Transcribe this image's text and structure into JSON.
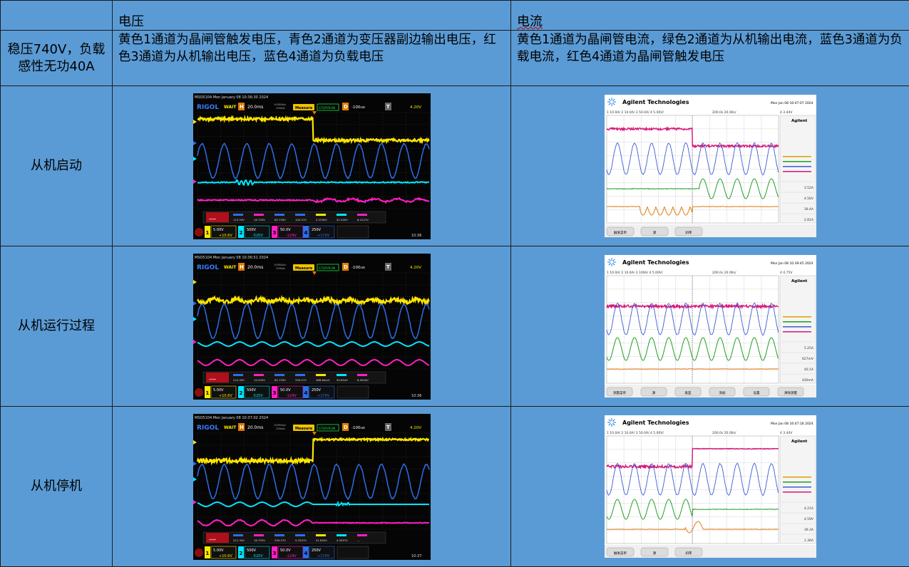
{
  "header": {
    "col_voltage": "电压",
    "col_current": "电流"
  },
  "condition_row": {
    "label": "稳压740V，负载感性无功40A",
    "voltage_desc": "黄色1通道为晶闸管触发电压，青色2通道为变压器副边输出电压，红色3通道为从机输出电压，蓝色4通道为负载电压",
    "current_desc": "黄色1通道为晶闸管电流，绿色2通道为从机输出电流，蓝色3通道为负载电流，红色4通道为晶闸管触发电压"
  },
  "rows": [
    {
      "label": "从机启动",
      "rigol": {
        "header": "MSO5104  Mon January 08 10:36:30 2024",
        "brand": "RIGOL",
        "status": "WAIT",
        "timebase": "20.0ms",
        "sample": "100MSa/s 20Mpts",
        "measure": "Measure",
        "stop": "STOP/RUN",
        "delay": "-100us",
        "trig": "4.20V",
        "meas_values": [
          "123.53V",
          "16.753V",
          "85.759V",
          "100.57V",
          "5.229kV",
          "51.945V",
          "6.1227V"
        ],
        "ch1": "5.00V",
        "ch1_off": "+10.6V",
        "ch2": "500V",
        "ch2_off": "-520V",
        "ch3": "50.0V",
        "ch3_off": "-124V",
        "ch4": "250V",
        "ch4_off": "+170V",
        "clock": "10:36"
      },
      "agilent": {
        "brand": "Agilent Technologies",
        "datetime": "Mon Jan 08 16:47:07 2024",
        "scales": "1  10.0A/   2  10.0A/   3  50.0A/   4  5.00V/",
        "time": "200.0s   20.00s/",
        "trig": "4   3.44V",
        "side_values": [
          "3.52A",
          "4.56V",
          "39.4A",
          "2.81A"
        ],
        "softkeys": [
          "触发菜单",
          "源",
          "斜率"
        ]
      }
    },
    {
      "label": "从机运行过程",
      "rigol": {
        "header": "MSO5104  Mon January 08 10:36:51 2024",
        "brand": "RIGOL",
        "status": "WAIT",
        "timebase": "20.0ms",
        "sample": "100MSa/s 20Mpts",
        "measure": "Measure",
        "stop": "STOP/RUN",
        "delay": "-100us",
        "trig": "4.20V",
        "meas_values": [
          "224.59V",
          "14.503V",
          "85.759V",
          "339.57V",
          "488.84mV",
          "55.654V",
          "6.0940V"
        ],
        "ch1": "5.00V",
        "ch1_off": "+10.6V",
        "ch2": "500V",
        "ch2_off": "-520V",
        "ch3": "50.0V",
        "ch3_off": "-124V",
        "ch4": "250V",
        "ch4_off": "+170V",
        "clock": "10:36"
      },
      "agilent": {
        "brand": "Agilent Technologies",
        "datetime": "Mon Jan 08 10:39:45 2024",
        "scales": "1  10.0A/   2  10.0A/   3  100A/   4  5.00V/",
        "time": "200.0s   20.00s/",
        "trig": "4   4.75V",
        "side_values": [
          "5.25A",
          "627mV",
          "40.1A",
          "430mA"
        ],
        "softkeys": [
          "测量菜单",
          "源",
          "类型",
          "添加",
          "设置",
          "清除测量"
        ]
      }
    },
    {
      "label": "从机停机",
      "rigol": {
        "header": "MSO5104  Mon January 08 10:37:02 2024",
        "brand": "RIGOL",
        "status": "WAIT",
        "timebase": "20.0ms",
        "sample": "100MSa/s 20Mpts",
        "measure": "Measure",
        "stop": "STOP/RUN",
        "delay": "-100us",
        "trig": "4.20V",
        "meas_values": [
          "221.34V",
          "16.753V",
          "339.57V",
          "5.2307V",
          "41.850V",
          "4.3597V",
          "..."
        ],
        "ch1": "5.00V",
        "ch1_off": "+10.6V",
        "ch2": "500V",
        "ch2_off": "-520V",
        "ch3": "50.0V",
        "ch3_off": "-124V",
        "ch4": "250V",
        "ch4_off": "+170V",
        "clock": "10:37"
      },
      "agilent": {
        "brand": "Agilent Technologies",
        "datetime": "Mon Jan 08 16:47:18 2024",
        "scales": "1  10.0A/   2  10.0A/   3  50.0A/   4  5.00V/",
        "time": "200.0s   20.00s/",
        "trig": "4   3.44V",
        "side_values": [
          "4.21A",
          "4.59V",
          "39.3A",
          "1.36A"
        ],
        "softkeys": [
          "触发菜单",
          "源",
          "斜率"
        ]
      }
    }
  ],
  "colors": {
    "cell_bg": "#5b9bd5",
    "border": "#1c1c1c",
    "rigol_yellow": "#ffe600",
    "rigol_blue": "#2e6de8",
    "rigol_cyan": "#00e5ff",
    "rigol_magenta": "#ff1fc2",
    "ag_magenta": "#d6157a",
    "ag_blue": "#3c5cd6",
    "ag_green": "#1fa020",
    "ag_orange": "#e07d10"
  }
}
